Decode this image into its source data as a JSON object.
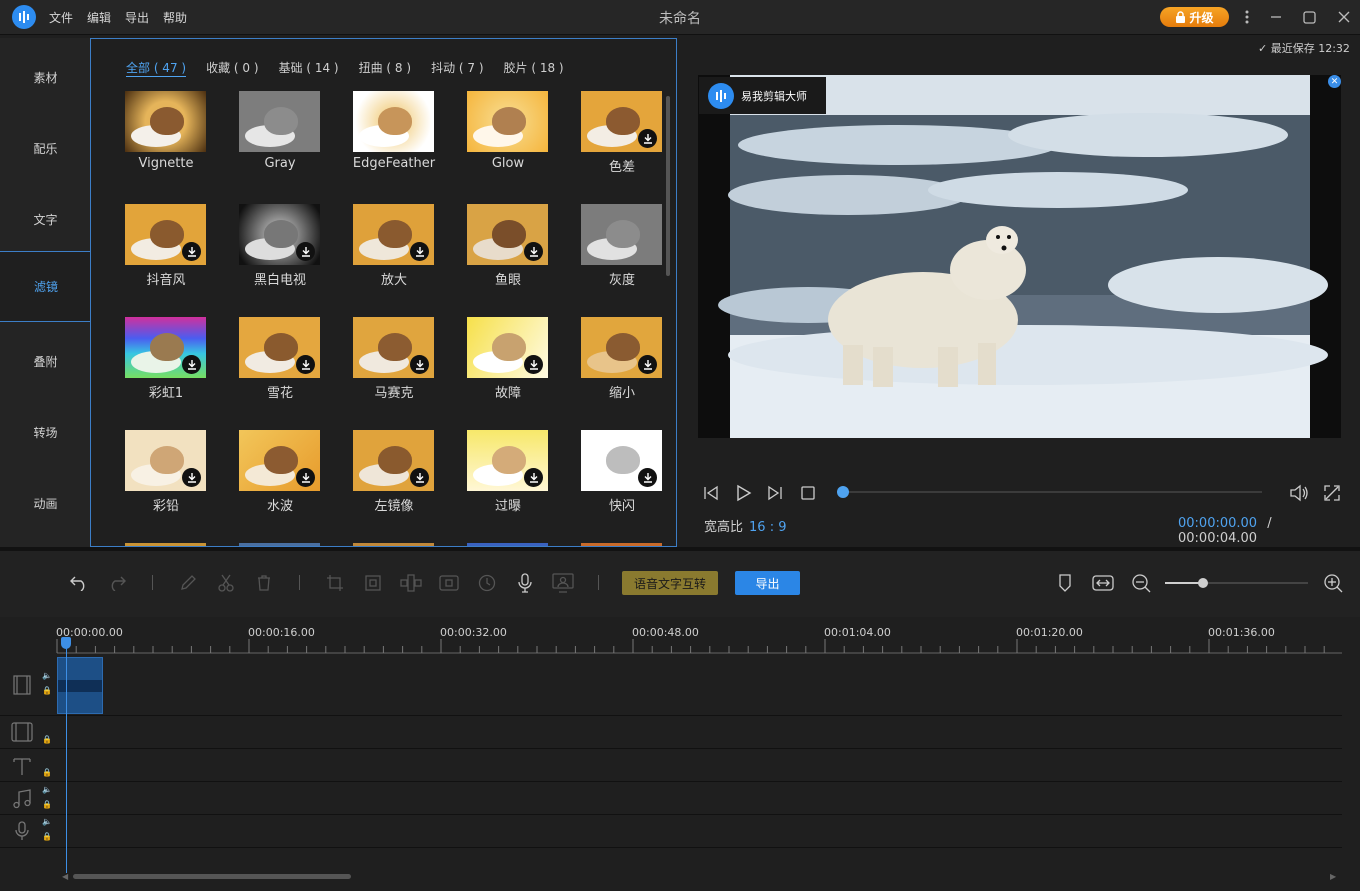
{
  "app": {
    "title": "未命名",
    "upgrade_label": "升级",
    "autosave": "最近保存 12:32"
  },
  "menu": [
    "文件",
    "编辑",
    "导出",
    "帮助"
  ],
  "sidebar": {
    "items": [
      {
        "label": "素材"
      },
      {
        "label": "配乐"
      },
      {
        "label": "文字"
      },
      {
        "label": "滤镜"
      },
      {
        "label": "叠附"
      },
      {
        "label": "转场"
      },
      {
        "label": "动画"
      }
    ],
    "active": "滤镜"
  },
  "filters": {
    "tabs": [
      {
        "label": "全部 ( 47 )"
      },
      {
        "label": "收藏 ( 0 )"
      },
      {
        "label": "基础 ( 14 )"
      },
      {
        "label": "扭曲 ( 8 )"
      },
      {
        "label": "抖动 ( 7 )"
      },
      {
        "label": "胶片 ( 18 )"
      }
    ],
    "active_tab": "全部 ( 47 )",
    "items": [
      {
        "label": "Vignette"
      },
      {
        "label": "Gray"
      },
      {
        "label": "EdgeFeather"
      },
      {
        "label": "Glow"
      },
      {
        "label": "色差"
      },
      {
        "label": "抖音风"
      },
      {
        "label": "黑白电视"
      },
      {
        "label": "放大"
      },
      {
        "label": "鱼眼"
      },
      {
        "label": "灰度"
      },
      {
        "label": "彩虹1"
      },
      {
        "label": "雪花"
      },
      {
        "label": "马赛克"
      },
      {
        "label": "故障"
      },
      {
        "label": "缩小"
      },
      {
        "label": "彩铅"
      },
      {
        "label": "水波"
      },
      {
        "label": "左镜像"
      },
      {
        "label": "过曝"
      },
      {
        "label": "快闪"
      }
    ]
  },
  "preview": {
    "ad_badge": "易我剪辑大师",
    "aspect_label": "宽高比",
    "aspect_value": "16 : 9",
    "current_time": "00:00:00.00",
    "time_sep": "/",
    "total_time": "00:00:04.00"
  },
  "toolbar": {
    "speech_text_label": "语音文字互转",
    "export_label": "导出"
  },
  "timeline": {
    "ruler": [
      "00:00:00.00",
      "00:00:16.00",
      "00:00:32.00",
      "00:00:48.00",
      "00:01:04.00",
      "00:01:20.00",
      "00:01:36.00"
    ]
  },
  "colors": {
    "accent": "#4fa3f0",
    "upgrade": "#f39a1e",
    "export": "#2b86e6",
    "speech_btn": "#8a7a2f"
  }
}
